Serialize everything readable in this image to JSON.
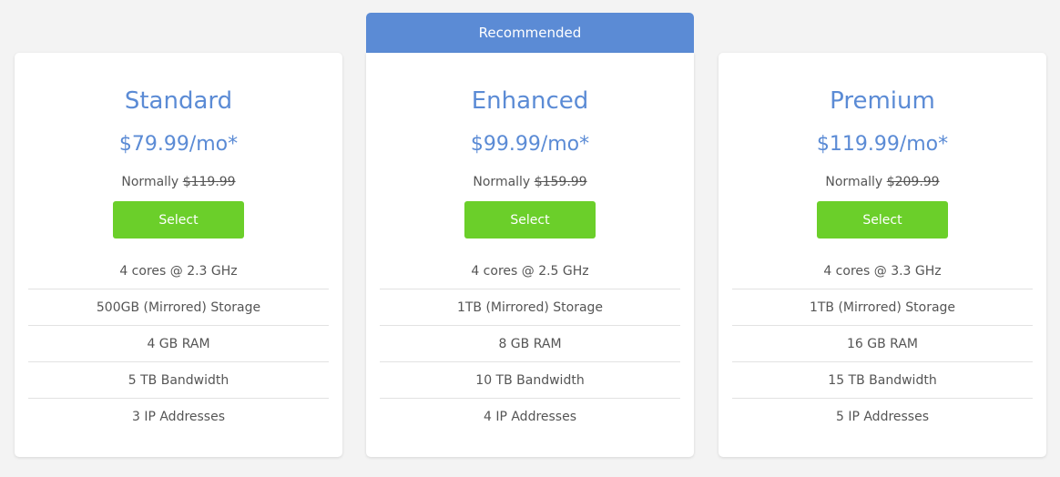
{
  "recommended_label": "Recommended",
  "normally_prefix": "Normally",
  "plans": [
    {
      "name": "Standard",
      "price": "$79.99/mo*",
      "normal_price": "$119.99",
      "button_label": "Select",
      "features": [
        "4 cores @ 2.3 GHz",
        "500GB (Mirrored) Storage",
        "4 GB RAM",
        "5 TB Bandwidth",
        "3 IP Addresses"
      ]
    },
    {
      "name": "Enhanced",
      "price": "$99.99/mo*",
      "normal_price": "$159.99",
      "button_label": "Select",
      "features": [
        "4 cores @ 2.5 GHz",
        "1TB (Mirrored) Storage",
        "8 GB RAM",
        "10 TB Bandwidth",
        "4 IP Addresses"
      ]
    },
    {
      "name": "Premium",
      "price": "$119.99/mo*",
      "normal_price": "$209.99",
      "button_label": "Select",
      "features": [
        "4 cores @ 3.3 GHz",
        "1TB (Mirrored) Storage",
        "16 GB RAM",
        "15 TB Bandwidth",
        "5 IP Addresses"
      ]
    }
  ],
  "colors": {
    "accent": "#5b8bd5",
    "button": "#6bcf2a",
    "background": "#f3f3f3"
  }
}
